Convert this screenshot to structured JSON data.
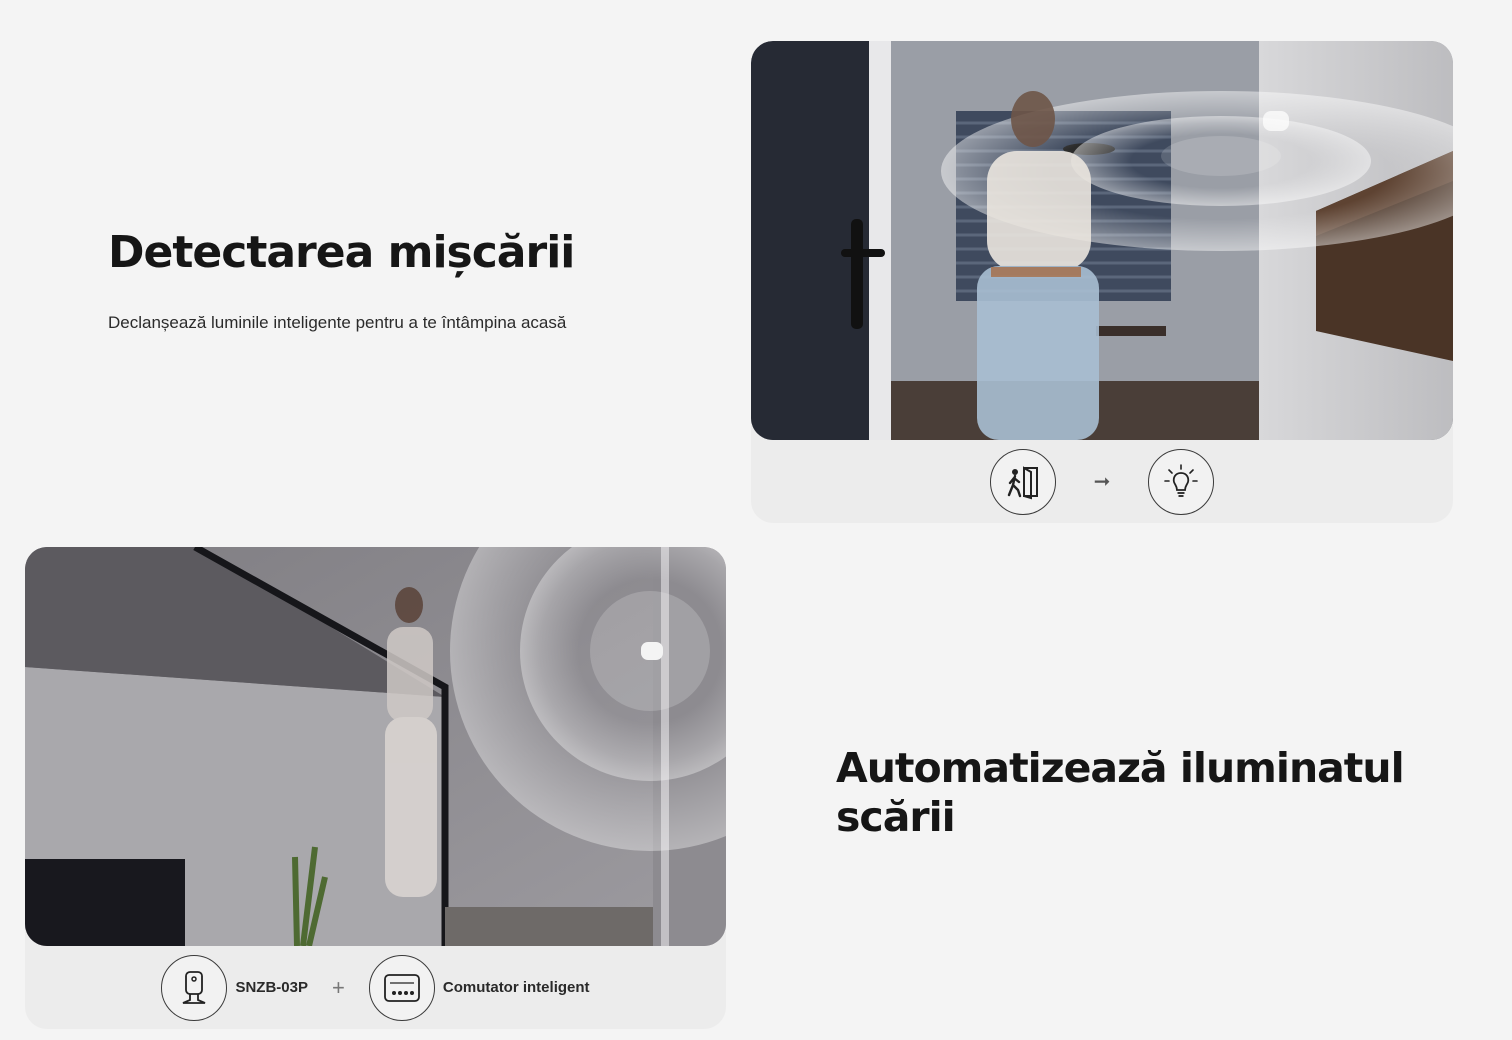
{
  "section1": {
    "heading": "Detectarea mișcării",
    "description": "Declanșează luminile inteligente pentru a te întâmpina acasă",
    "icons": [
      "person-entering-door-icon",
      "arrow-right-icon",
      "light-bulb-icon"
    ]
  },
  "section2": {
    "heading_line1": "Automatizează iluminatul",
    "heading_line2": "scării",
    "product_label": "SNZB-03P",
    "plus": "+",
    "switch_label": "Comutator inteligent",
    "icons": [
      "motion-sensor-icon",
      "smart-switch-icon"
    ]
  }
}
